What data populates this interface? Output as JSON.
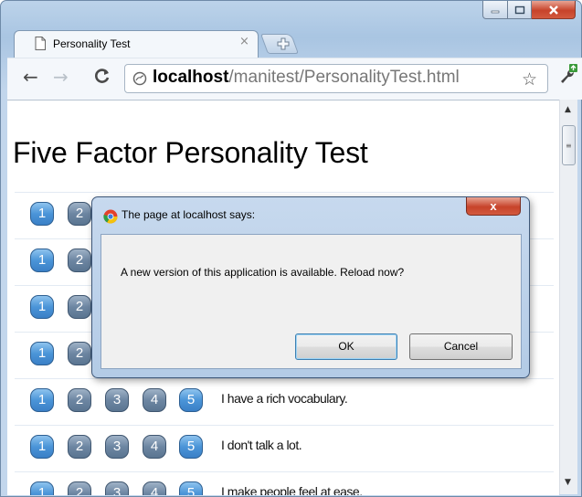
{
  "browser": {
    "tab_title": "Personality Test",
    "tab_close": "×",
    "url_host": "localhost",
    "url_path": "/manitest/PersonalityTest.html"
  },
  "page": {
    "title": "Five Factor Personality Test",
    "rating_labels": [
      "1",
      "2",
      "3",
      "4",
      "5"
    ],
    "questions": [
      {
        "text": ""
      },
      {
        "text": ""
      },
      {
        "text": ""
      },
      {
        "text": ""
      },
      {
        "text": "I have a rich vocabulary."
      },
      {
        "text": "I don't talk a lot."
      },
      {
        "text": "I make people feel at ease."
      }
    ]
  },
  "dialog": {
    "title": "The page at localhost says:",
    "close": "x",
    "message": "A new version of this application is available. Reload now?",
    "ok_label": "OK",
    "cancel_label": "Cancel"
  },
  "icons": [
    "document-icon",
    "new-tab-icon",
    "back-icon",
    "forward-icon",
    "reload-icon",
    "globe-icon",
    "star-icon",
    "wrench-icon",
    "chrome-icon"
  ],
  "colors": {
    "rating_button_blue": "#4b95d8",
    "rating_button_gray": "#6d86a2",
    "close_red": "#c7432a"
  }
}
